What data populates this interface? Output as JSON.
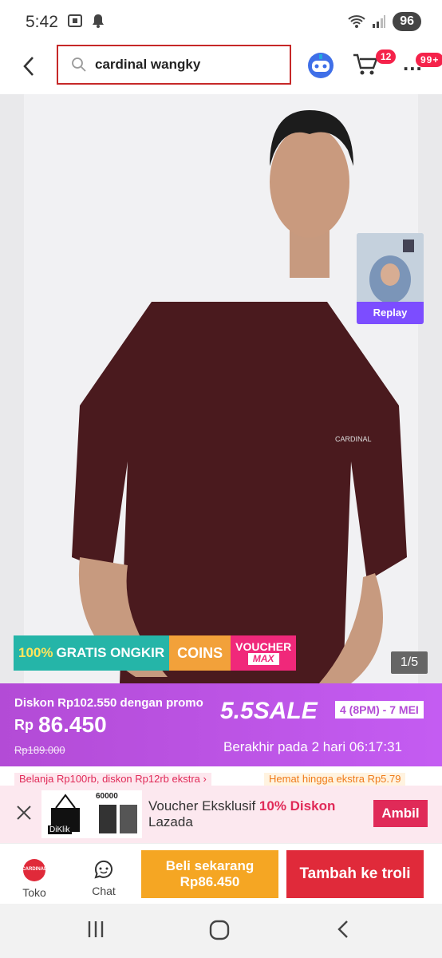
{
  "status": {
    "time": "5:42",
    "battery": "96"
  },
  "header": {
    "search_query": "cardinal wangky",
    "cart_count": "12",
    "more_count": "99+",
    "more_label": "..."
  },
  "image": {
    "replay_label": "Replay",
    "counter": "1/5"
  },
  "promo_strip": {
    "free_ship_pct": "100%",
    "free_ship": "GRATIS ONGKIR",
    "coins": "COINS",
    "voucher": "VOUCHER",
    "voucher_max": "MAX"
  },
  "sale": {
    "discount_text": "Diskon Rp102.550 dengan promo",
    "currency": "Rp",
    "price": "86.450",
    "old_price": "Rp189.000",
    "campaign": "5.5SALE",
    "dates": "4 (8PM) - 7 MEI",
    "ends": "Berakhir pada 2 hari 06:17:31"
  },
  "vouchers": {
    "v1": "Belanja Rp100rb, diskon Rp12rb ekstra ›",
    "v2": "Hemat hingga ekstra Rp5.79"
  },
  "voucher_bar": {
    "text_prefix": "Voucher Eksklusif ",
    "text_highlight": "10% Diskon",
    "text_suffix": "Lazada",
    "cta": "Ambil",
    "thumb_brand": "DiKlik",
    "thumb_number": "60000"
  },
  "bottom": {
    "toko": "Toko",
    "chat": "Chat",
    "buy_label": "Beli sekarang",
    "buy_price": "Rp86.450",
    "cart_label": "Tambah ke troli",
    "toko_logo": "CARDINAL"
  },
  "colors": {
    "accent": "#e02a3a",
    "sale_bg": "#c45cf2",
    "buy_bg": "#f5a623"
  }
}
